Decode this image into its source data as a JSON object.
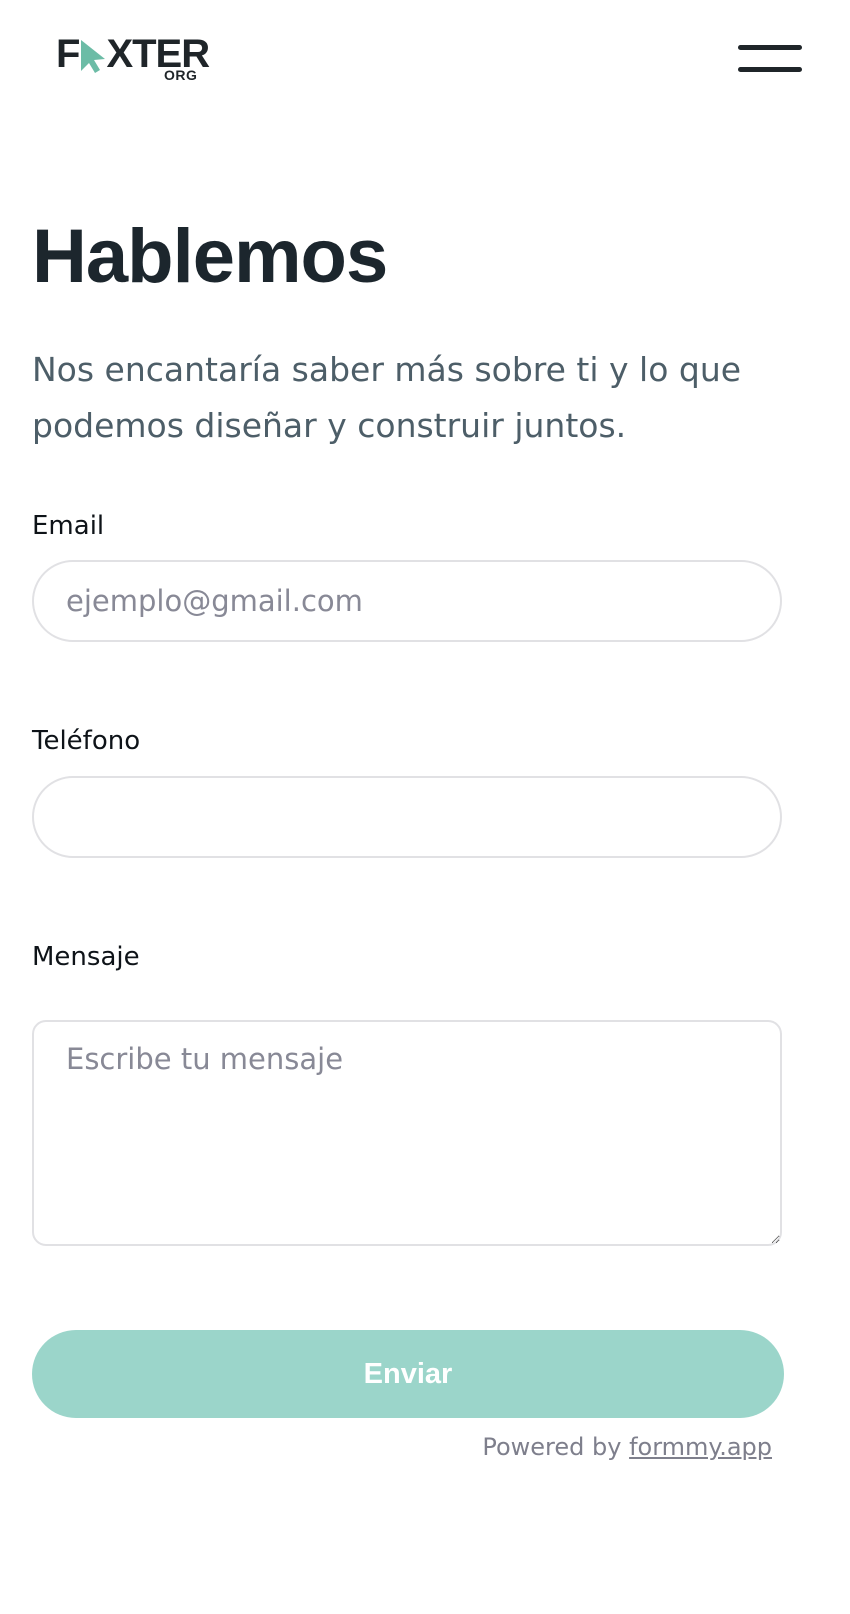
{
  "header": {
    "logo_text": "FAXTER",
    "logo_text_left": "F",
    "logo_text_right": "XTER",
    "logo_subtext": "ORG",
    "menu_icon": "hamburger-menu-icon"
  },
  "hero": {
    "title": "Hablemos",
    "subtitle": "Nos encantaría saber más sobre ti y lo que podemos diseñar y construir juntos."
  },
  "form": {
    "email": {
      "label": "Email",
      "placeholder": "ejemplo@gmail.com",
      "value": ""
    },
    "phone": {
      "label": "Teléfono",
      "placeholder": "",
      "value": ""
    },
    "message": {
      "label": "Mensaje",
      "placeholder": "Escribe tu mensaje",
      "value": ""
    },
    "submit_label": "Enviar"
  },
  "footer": {
    "powered_prefix": "Powered by",
    "powered_link": "formmy.app"
  },
  "colors": {
    "accent": "#9bd5ca",
    "logo_cursor": "#6cbca6",
    "text_dark": "#1c262d",
    "text_muted": "#4d5e68",
    "placeholder": "#888996",
    "border": "#e1e1e4"
  }
}
